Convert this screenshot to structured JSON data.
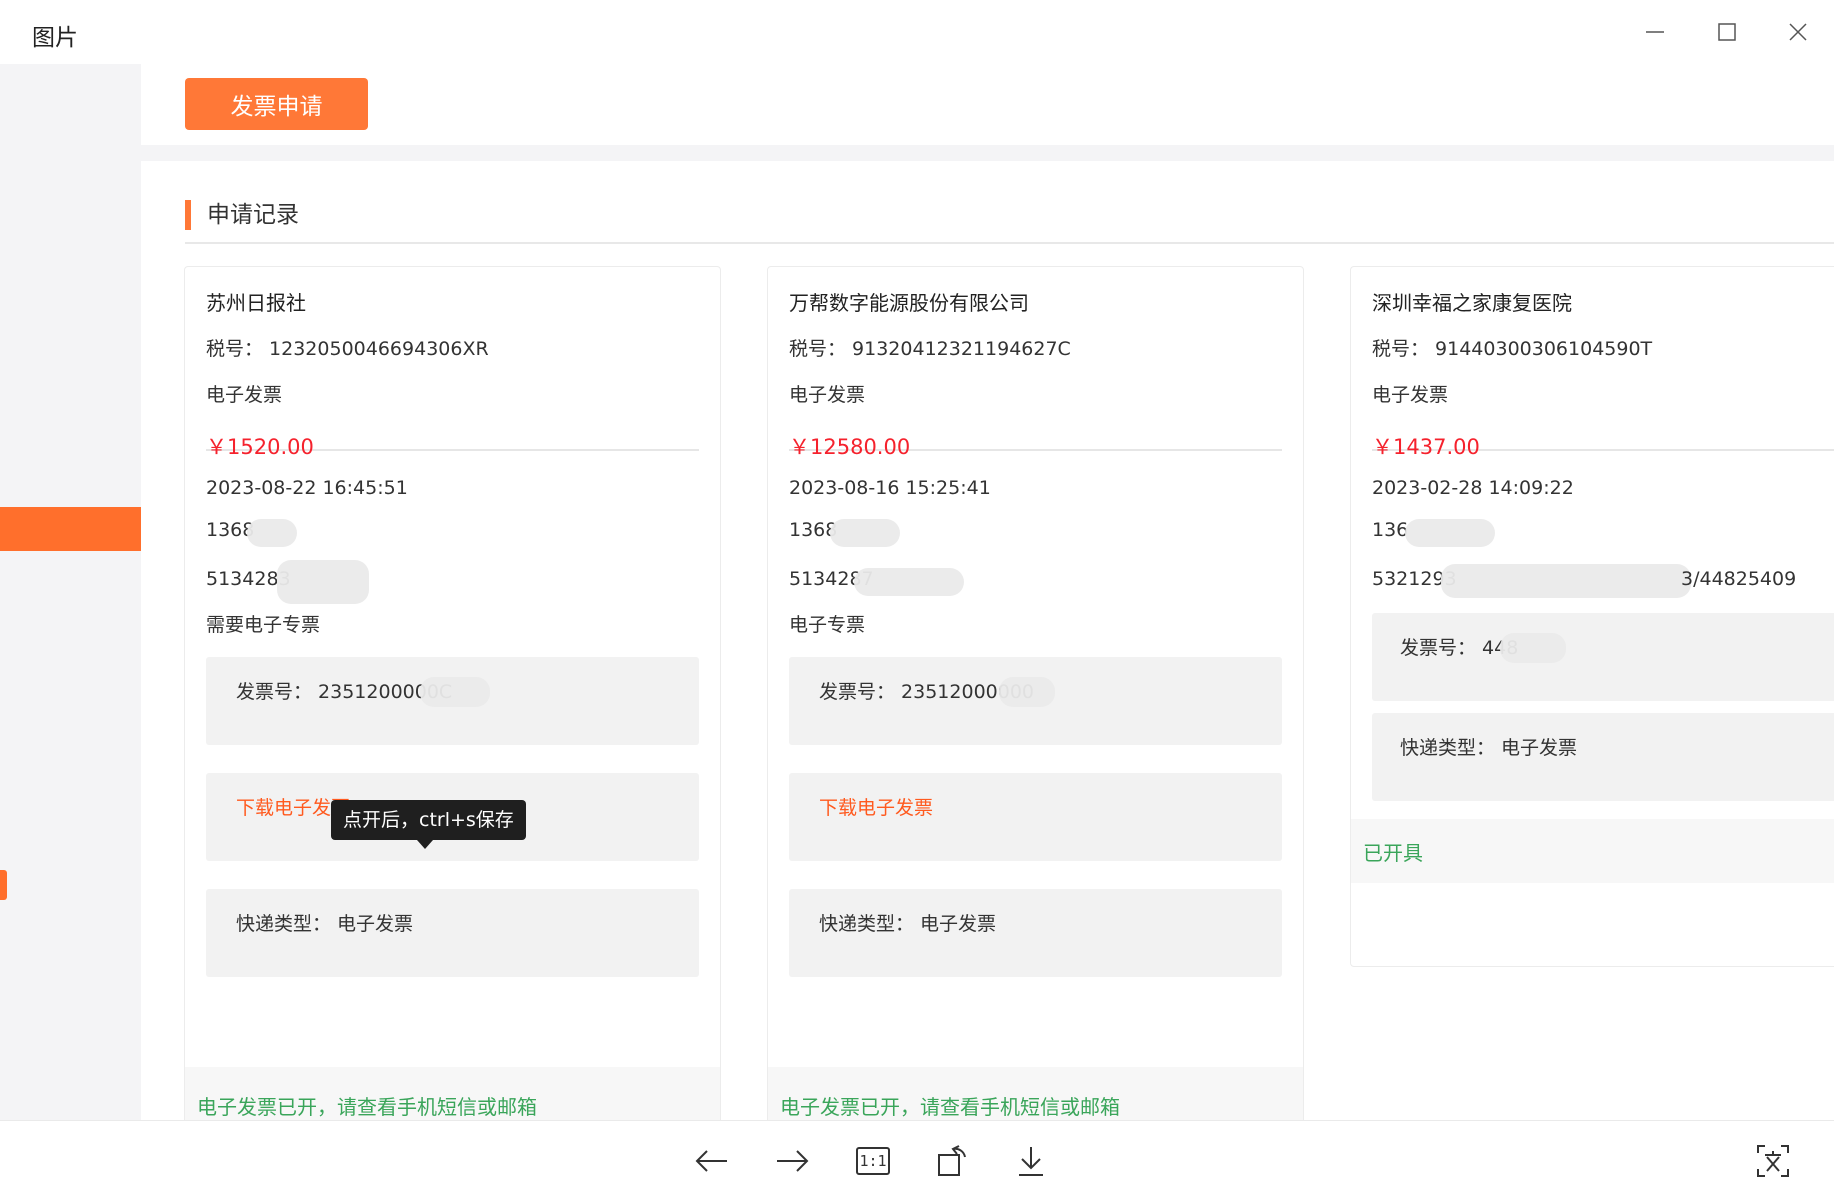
{
  "window": {
    "title": "图片"
  },
  "page": {
    "apply_button": "发票申请",
    "section_title": "申请记录"
  },
  "cards": [
    {
      "company": "苏州日报社",
      "tax_id": "税号：  1232050046694306XR",
      "invoice_type": "电子发票",
      "amount": "￥1520.00",
      "datetime": "2023-08-22 16:45:51",
      "phone": "1368",
      "address": "5134283",
      "note": "需要电子专票",
      "invoice_no": "发票号：  2351200000C",
      "download_link": "下载电子发票",
      "express_type": "快递类型：  电子发票",
      "status": "电子发票已开，请查看手机短信或邮箱"
    },
    {
      "company": "万帮数字能源股份有限公司",
      "tax_id": "税号：  91320412321194627C",
      "invoice_type": "电子发票",
      "amount": "￥12580.00",
      "datetime": "2023-08-16 15:25:41",
      "phone": "1368",
      "address": "5134287",
      "note": "电子专票",
      "invoice_no": "发票号：  23512000000",
      "download_link": "下载电子发票",
      "express_type": "快递类型：  电子发票",
      "status": "电子发票已开，请查看手机短信或邮箱"
    },
    {
      "company": "深圳幸福之家康复医院",
      "tax_id": "税号：  91440300306104590T",
      "invoice_type": "电子发票",
      "amount": "￥1437.00",
      "datetime": "2023-02-28 14:09:22",
      "phone": "136",
      "address": "5321293",
      "address_tail": "3/44825409",
      "invoice_no": "发票号：  448",
      "express_type": "快递类型：  电子发票",
      "status": "已开具"
    }
  ],
  "tooltip": "点开后，ctrl+s保存",
  "toolbar": {
    "prev": "arrow-left-icon",
    "next": "arrow-right-icon",
    "actual_size": "1:1",
    "rotate": "rotate-icon",
    "download": "download-icon",
    "ocr": "text-recognition-icon"
  },
  "colors": {
    "accent": "#ff7837",
    "amount": "#f5222d",
    "status": "#3aa55a",
    "link": "#ff5a1f"
  }
}
